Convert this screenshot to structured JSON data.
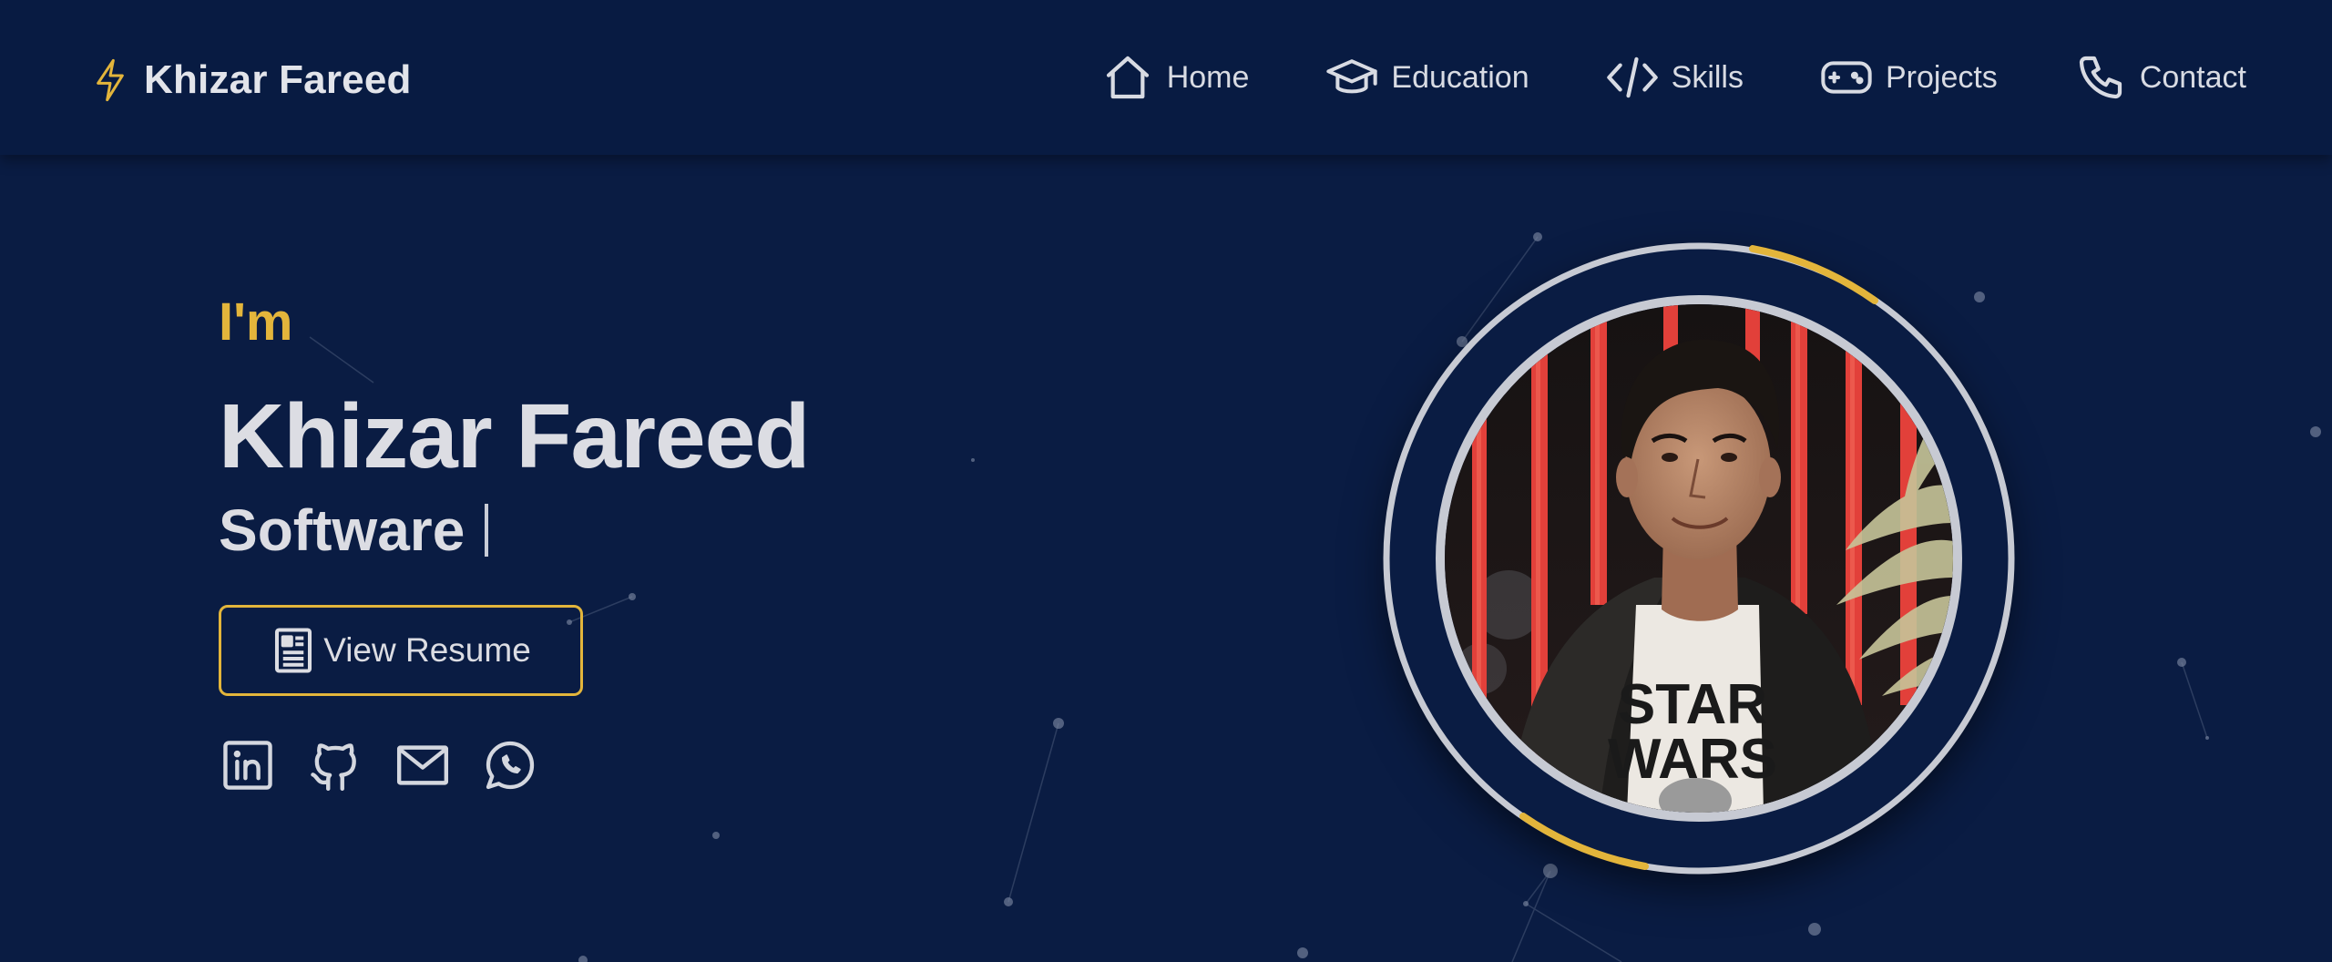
{
  "brand": {
    "name": "Khizar Fareed",
    "icon": "lightning-bolt-icon"
  },
  "nav": {
    "items": [
      {
        "label": "Home",
        "icon": "home-icon"
      },
      {
        "label": "Education",
        "icon": "graduation-cap-icon"
      },
      {
        "label": "Skills",
        "icon": "code-icon"
      },
      {
        "label": "Projects",
        "icon": "gamepad-icon"
      },
      {
        "label": "Contact",
        "icon": "phone-icon"
      }
    ]
  },
  "hero": {
    "intro": "I'm",
    "name": "Khizar Fareed",
    "role": "Software",
    "resume_button": "View Resume",
    "socials": [
      {
        "name": "LinkedIn",
        "icon": "linkedin-icon"
      },
      {
        "name": "GitHub",
        "icon": "github-icon"
      },
      {
        "name": "Email",
        "icon": "mail-icon"
      },
      {
        "name": "WhatsApp",
        "icon": "whatsapp-icon"
      }
    ]
  },
  "profile": {
    "photo": "profile-photo",
    "ring_accent": "#e3b53b"
  },
  "colors": {
    "background": "#0a1c43",
    "navbar": "#081b42",
    "accent": "#e3b53b",
    "text": "#dcdde3"
  }
}
